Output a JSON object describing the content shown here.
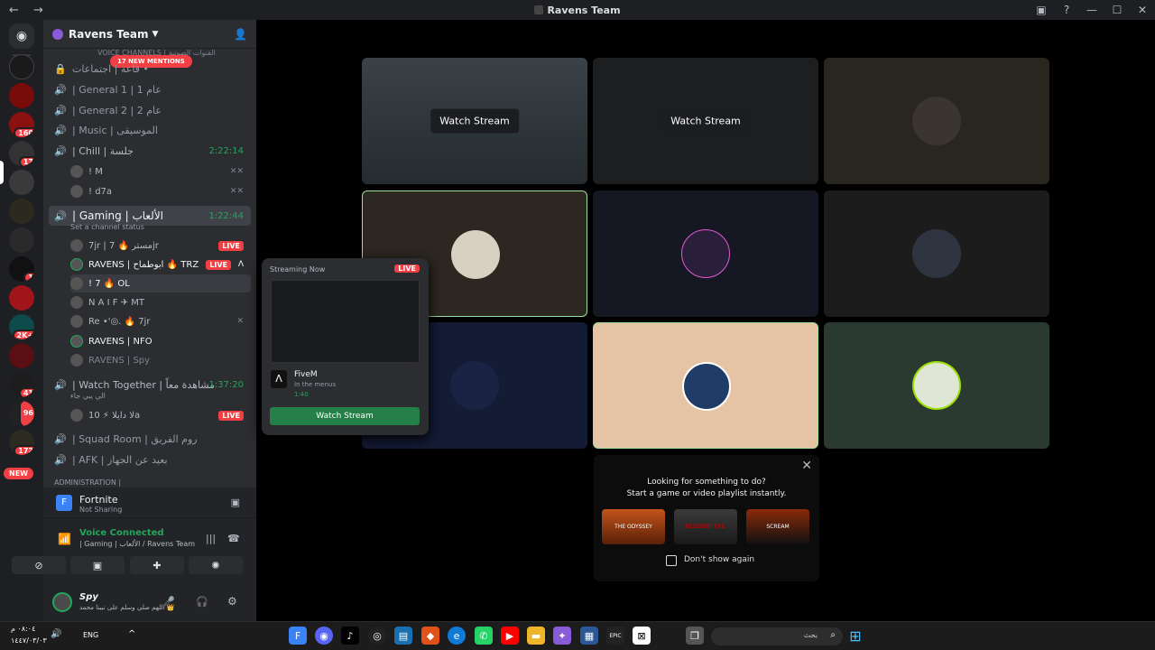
{
  "window": {
    "title": "Ravens Team",
    "nav": "← →",
    "controls": [
      "▣",
      "?",
      "—",
      "☐",
      "✕"
    ]
  },
  "server": {
    "name": "Ravens Team",
    "category": "VOICE CHANNELS | القنوات الصوتية",
    "mentions": "17 NEW MENTIONS",
    "new_label": "NEW"
  },
  "rail_badges": [
    "160",
    "17",
    "1",
    "2K+",
    "41",
    "96",
    "172"
  ],
  "channels": [
    {
      "label": "قاعة | اجتماعات •",
      "icon": "🔒"
    },
    {
      "label": "| General 1 | عام 1",
      "icon": "🔊"
    },
    {
      "label": "| General 2 | عام 2",
      "icon": "🔊"
    },
    {
      "label": "| Music | الموسيقى",
      "icon": "🔊"
    },
    {
      "label": "| Chill | جلسة",
      "icon": "🔊",
      "time": "2:22:14"
    },
    {
      "label": "| Gaming | الألعاب",
      "icon": "🔊",
      "time": "1:22:44",
      "status": "Set a channel status"
    },
    {
      "label": "| Watch Together | مشاهدة معاً",
      "icon": "🔊",
      "time": "1:37:20",
      "sub": "الي يبي جاء"
    },
    {
      "label": "| Squad Room | روم الفريق",
      "icon": "🔊"
    },
    {
      "label": "| AFK | بعيد عن الجهاز",
      "icon": "🔊"
    },
    {
      "label": "ADMINISTRATION |",
      "icon": ""
    }
  ],
  "chill_users": [
    "! M",
    "! d7a"
  ],
  "gaming_users": [
    {
      "name": "7jr | مستر 🔥 7jr",
      "live": "LIVE"
    },
    {
      "name": "RAVENS | ابوطماح 🔥 TRZ",
      "live": "LIVE"
    },
    {
      "name": "! 7 🔥 OL"
    },
    {
      "name": "N A I F ✈ MT"
    },
    {
      "name": "Re •'◎. 🔥 7jr"
    },
    {
      "name": "RAVENS | NFO"
    },
    {
      "name": "RAVENS | Spy"
    }
  ],
  "watch_user": {
    "name": "لا دايلا ⚡ 10a",
    "live": "LIVE"
  },
  "sharing": {
    "game": "Fortnite",
    "status": "Not Sharing"
  },
  "voice": {
    "status": "Voice Connected",
    "channel": "| Gaming | الألعاب / Ravens Team"
  },
  "user": {
    "name": "Spy",
    "status": "اللهم صلي وسلم على نبينا محمد 👑"
  },
  "grid": {
    "watch_label": "Watch Stream"
  },
  "popup": {
    "header": "Streaming Now",
    "live": "LIVE",
    "app": "FiveM",
    "activity": "In the menus",
    "elapsed": "1:40",
    "button": "Watch Stream"
  },
  "activity": {
    "line1": "Looking for something to do?",
    "line2": "Start a game or video playlist instantly.",
    "dont_show": "Don't show again",
    "games": [
      "THE ODYSSEY",
      "RESIDENT EVIL",
      "SCREAM"
    ]
  },
  "taskbar": {
    "time": "٠٨:٠٤ م",
    "date": "١٤٤٧/٠٣/٠٣",
    "lang": "ENG",
    "search": "بحث"
  }
}
